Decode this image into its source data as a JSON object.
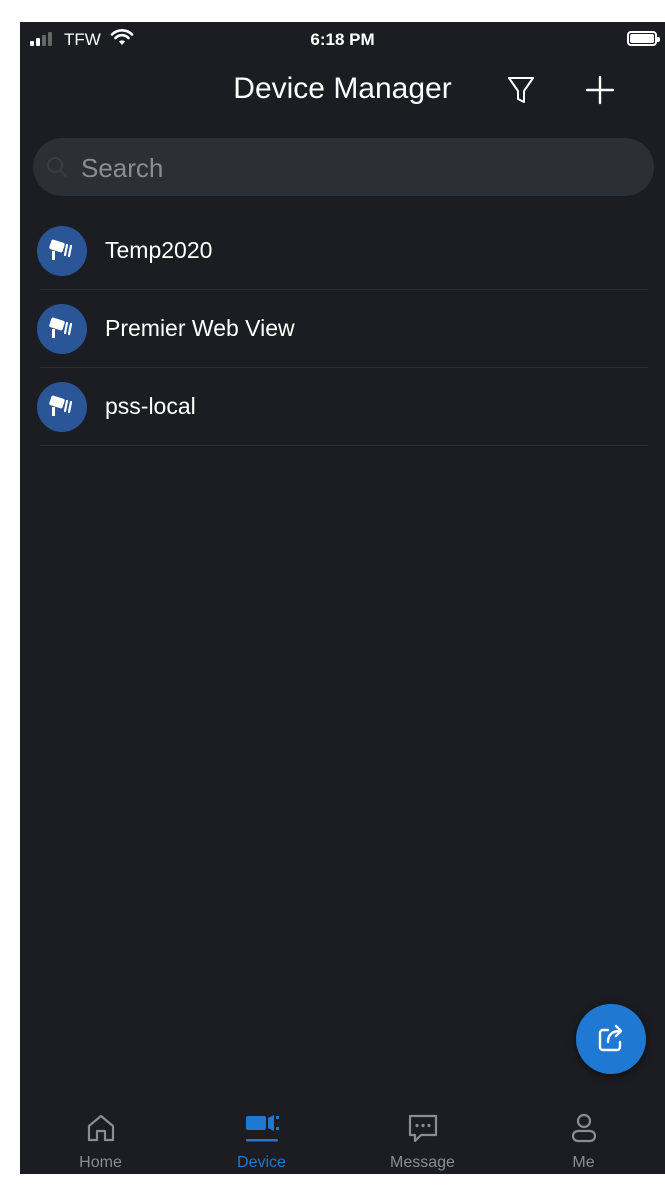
{
  "status_bar": {
    "carrier": "TFW",
    "time": "6:18 PM"
  },
  "header": {
    "title": "Device Manager",
    "filter_icon": "filter-funnel-icon",
    "add_icon": "plus-icon"
  },
  "search": {
    "placeholder": "Search",
    "value": ""
  },
  "devices": [
    {
      "name": "Temp2020",
      "icon": "security-camera-icon"
    },
    {
      "name": "Premier Web View",
      "icon": "security-camera-icon"
    },
    {
      "name": "pss-local",
      "icon": "security-camera-icon"
    }
  ],
  "fab": {
    "icon": "share-export-icon"
  },
  "tabs": [
    {
      "label": "Home",
      "icon": "home-icon",
      "active": false
    },
    {
      "label": "Device",
      "icon": "device-camera-icon",
      "active": true
    },
    {
      "label": "Message",
      "icon": "message-bubble-icon",
      "active": false
    },
    {
      "label": "Me",
      "icon": "person-icon",
      "active": false
    }
  ],
  "colors": {
    "background": "#1b1d22",
    "accent": "#1f78d1",
    "avatar": "#2a5596",
    "inactive_tab": "#8a8d94"
  }
}
